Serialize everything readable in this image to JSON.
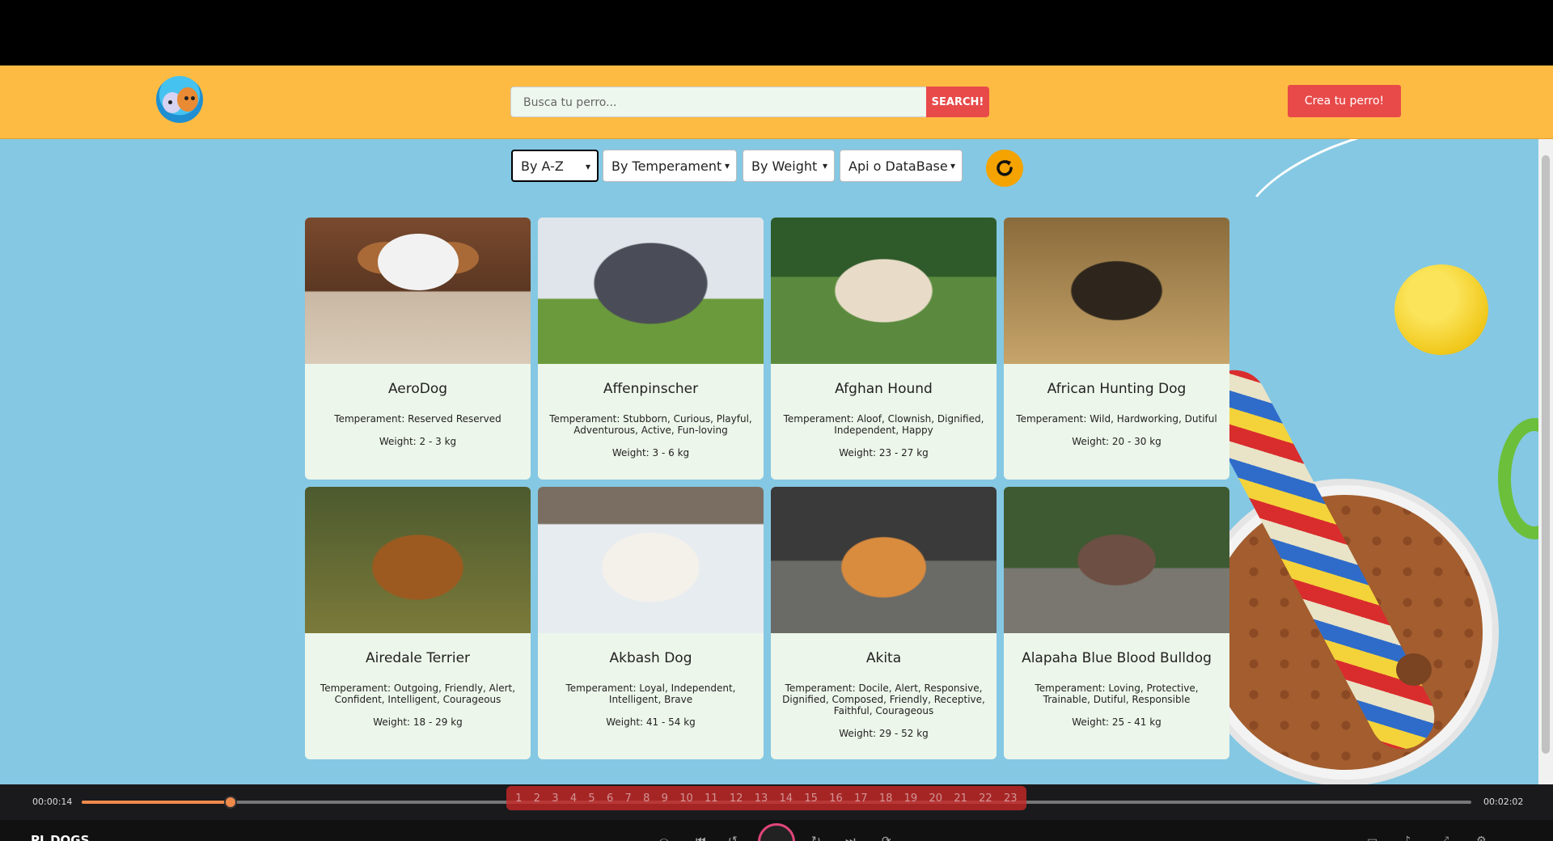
{
  "navbar": {
    "search_placeholder": "Busca tu perro...",
    "search_button": "SEARCH!",
    "create_button": "Crea tu perro!"
  },
  "filters": [
    {
      "label": "By A-Z"
    },
    {
      "label": "By Temperament"
    },
    {
      "label": "By Weight"
    },
    {
      "label": "Api o DataBase"
    }
  ],
  "dogs": [
    {
      "name": "AeroDog",
      "temperament": "Temperament: Reserved Reserved",
      "weight": "Weight: 2 - 3 kg"
    },
    {
      "name": "Affenpinscher",
      "temperament": "Temperament: Stubborn, Curious, Playful, Adventurous, Active, Fun-loving",
      "weight": "Weight: 3 - 6 kg"
    },
    {
      "name": "Afghan Hound",
      "temperament": "Temperament: Aloof, Clownish, Dignified, Independent, Happy",
      "weight": "Weight: 23 - 27 kg"
    },
    {
      "name": "African Hunting Dog",
      "temperament": "Temperament: Wild, Hardworking, Dutiful",
      "weight": "Weight: 20 - 30 kg"
    },
    {
      "name": "Airedale Terrier",
      "temperament": "Temperament: Outgoing, Friendly, Alert, Confident, Intelligent, Courageous",
      "weight": "Weight: 18 - 29 kg"
    },
    {
      "name": "Akbash Dog",
      "temperament": "Temperament: Loyal, Independent, Intelligent, Brave",
      "weight": "Weight: 41 - 54 kg"
    },
    {
      "name": "Akita",
      "temperament": "Temperament: Docile, Alert, Responsive, Dignified, Composed, Friendly, Receptive, Faithful, Courageous",
      "weight": "Weight: 29 - 52 kg"
    },
    {
      "name": "Alapaha Blue Blood Bulldog",
      "temperament": "Temperament: Loving, Protective, Trainable, Dutiful, Responsible",
      "weight": "Weight: 25 - 41 kg"
    }
  ],
  "pagination": [
    "1",
    "2",
    "3",
    "4",
    "5",
    "6",
    "7",
    "8",
    "9",
    "10",
    "11",
    "12",
    "13",
    "14",
    "15",
    "16",
    "17",
    "18",
    "19",
    "20",
    "21",
    "22",
    "23"
  ],
  "player": {
    "time_elapsed": "00:00:14",
    "time_total": "00:02:02",
    "progress": 0.107,
    "app_name": "PI_DOGS"
  }
}
